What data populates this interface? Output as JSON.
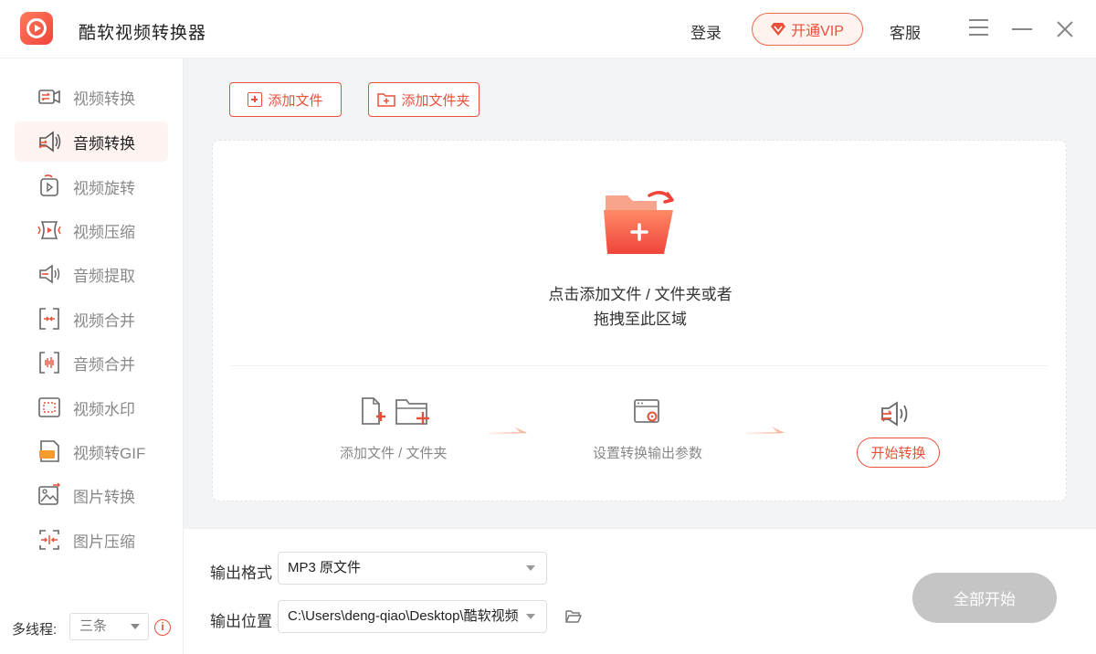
{
  "app": {
    "title": "酷软视频转换器"
  },
  "header": {
    "login": "登录",
    "vip": "开通VIP",
    "service": "客服"
  },
  "sidebar": {
    "items": [
      {
        "label": "视频转换",
        "icon": "video-convert-icon",
        "active": false
      },
      {
        "label": "音频转换",
        "icon": "audio-convert-icon",
        "active": true
      },
      {
        "label": "视频旋转",
        "icon": "video-rotate-icon",
        "active": false
      },
      {
        "label": "视频压缩",
        "icon": "video-compress-icon",
        "active": false
      },
      {
        "label": "音频提取",
        "icon": "audio-extract-icon",
        "active": false
      },
      {
        "label": "视频合并",
        "icon": "video-merge-icon",
        "active": false
      },
      {
        "label": "音频合并",
        "icon": "audio-merge-icon",
        "active": false
      },
      {
        "label": "视频水印",
        "icon": "video-watermark-icon",
        "active": false
      },
      {
        "label": "视频转GIF",
        "icon": "gif-icon",
        "active": false
      },
      {
        "label": "图片转换",
        "icon": "image-convert-icon",
        "active": false
      },
      {
        "label": "图片压缩",
        "icon": "image-compress-icon",
        "active": false
      }
    ],
    "thread_label": "多线程:",
    "thread_value": "三条"
  },
  "toolbar": {
    "add_file": "添加文件",
    "add_folder": "添加文件夹"
  },
  "dropzone": {
    "line1": "点击添加文件 / 文件夹或者",
    "line2": "拖拽至此区域",
    "step1": "添加文件 / 文件夹",
    "step2": "设置转换输出参数",
    "step3": "开始转换"
  },
  "output": {
    "format_label": "输出格式",
    "format_value": "MP3  原文件",
    "location_label": "输出位置",
    "location_value": "C:\\Users\\deng-qiao\\Desktop\\酷软视频",
    "start_all": "全部开始"
  },
  "colors": {
    "accent": "#e8503a",
    "disabled": "#c5c5c5"
  }
}
